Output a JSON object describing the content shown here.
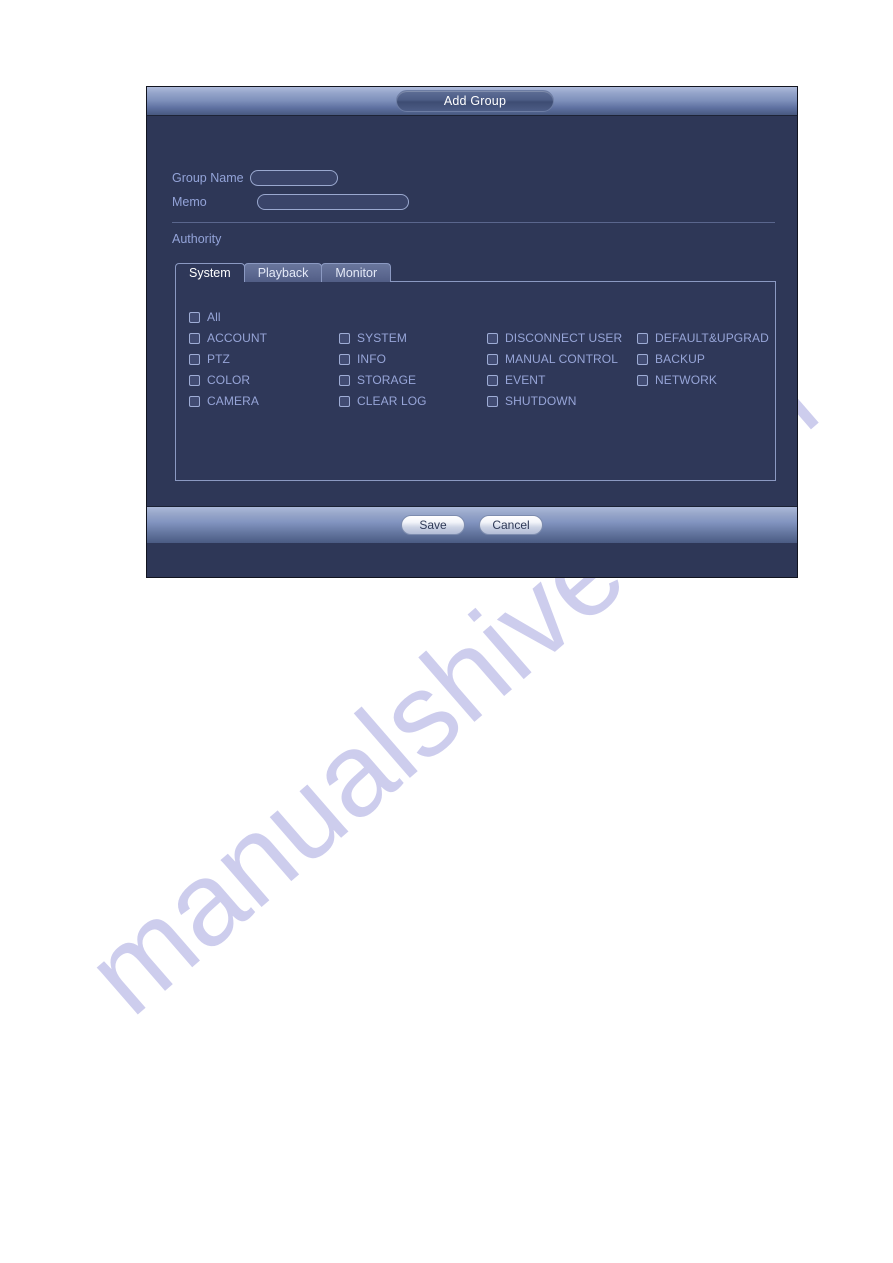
{
  "dialog": {
    "title": "Add Group",
    "fields": {
      "group_name_label": "Group Name",
      "group_name_value": "",
      "group_name_placeholder": "",
      "memo_label": "Memo",
      "memo_value": "",
      "memo_placeholder": ""
    },
    "authority_label": "Authority",
    "tabs": [
      {
        "label": "System",
        "active": true
      },
      {
        "label": "Playback",
        "active": false
      },
      {
        "label": "Monitor",
        "active": false
      }
    ],
    "permissions": {
      "columns": [
        {
          "items": [
            {
              "label": "All",
              "checked": false
            },
            {
              "label": "ACCOUNT",
              "checked": false
            },
            {
              "label": "PTZ",
              "checked": false
            },
            {
              "label": "COLOR",
              "checked": false
            },
            {
              "label": "CAMERA",
              "checked": false
            }
          ]
        },
        {
          "items": [
            {
              "label": "SYSTEM",
              "checked": false
            },
            {
              "label": "INFO",
              "checked": false
            },
            {
              "label": "STORAGE",
              "checked": false
            },
            {
              "label": "CLEAR LOG",
              "checked": false
            }
          ]
        },
        {
          "items": [
            {
              "label": "DISCONNECT USER",
              "checked": false
            },
            {
              "label": "MANUAL CONTROL",
              "checked": false
            },
            {
              "label": "EVENT",
              "checked": false
            },
            {
              "label": "SHUTDOWN",
              "checked": false
            }
          ]
        },
        {
          "items": [
            {
              "label": "DEFAULT&UPGRAD",
              "checked": false
            },
            {
              "label": "BACKUP",
              "checked": false
            },
            {
              "label": "NETWORK",
              "checked": false
            }
          ]
        }
      ]
    },
    "footer": {
      "save_label": "Save",
      "cancel_label": "Cancel"
    }
  },
  "watermark": {
    "text": "manualshive.com"
  },
  "colors": {
    "dialog_background": "#2e3757",
    "panel_background": "#2f3859",
    "label_text": "#93a3d8",
    "title_bar_top": "#aebada",
    "title_bar_bottom": "#47587f",
    "watermark": "#5b5bc4"
  }
}
